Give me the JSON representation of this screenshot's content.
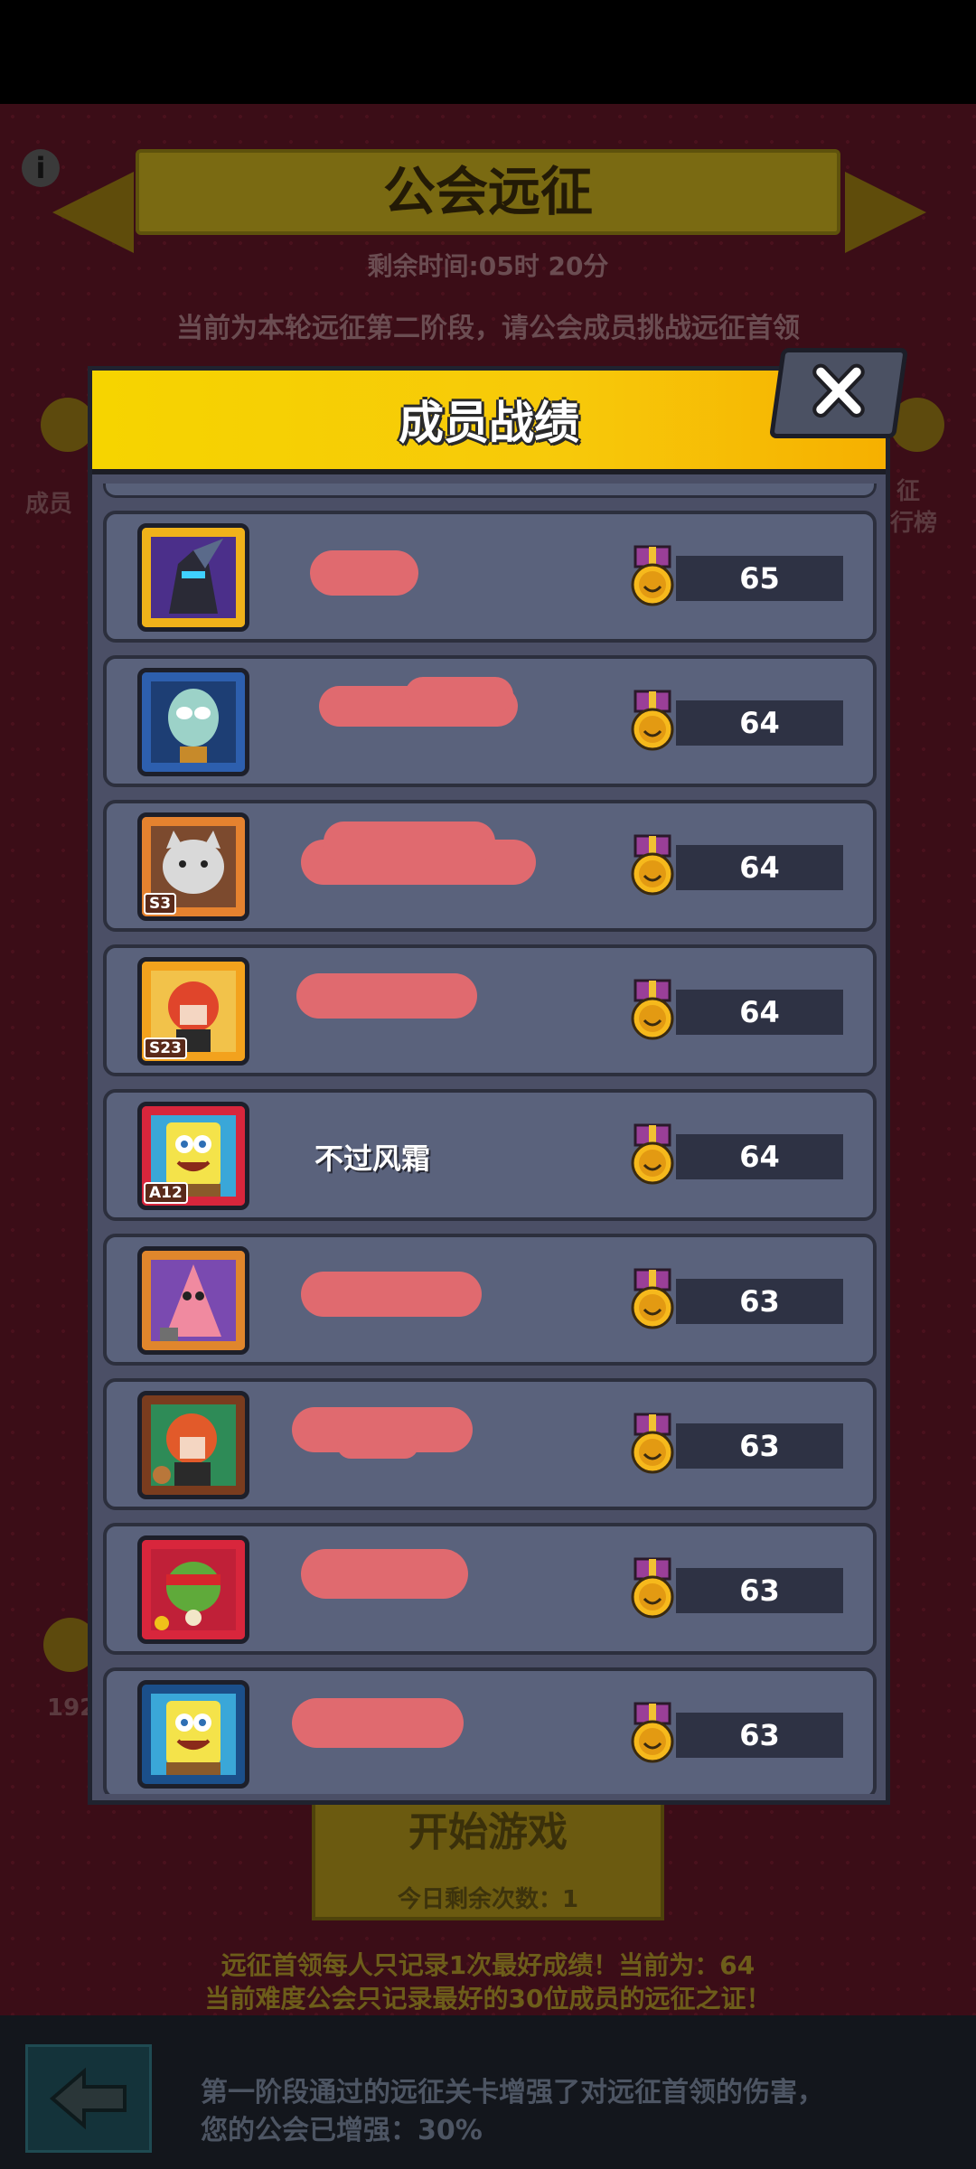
{
  "background": {
    "title": "公会远征",
    "time_remaining": "剩余时间:05时 20分",
    "stage_notice": "当前为本轮远征第二阶段，请公会成员挑战远征首领",
    "left_label": "成员",
    "right_label_top": "征",
    "right_label_bottom": "行榜",
    "left_bottom_number": "192",
    "start_button": "开始游戏",
    "remaining_tries": "今日剩余次数：1",
    "note_line1": "远征首领每人只记录1次最好成绩！当前为：64",
    "note_line2": "当前难度公会只记录最好的30位成员的远征之证！",
    "bottom_line1": "第一阶段通过的远征关卡增强了对远征首领的伤害，",
    "bottom_line2": "您的公会已增强：30%",
    "info_icon": "i"
  },
  "modal": {
    "title": "成员战绩",
    "close_icon": "close-icon",
    "members": [
      {
        "name": "",
        "score": "65",
        "avatar": "dark-knight-avatar",
        "frame_color": "#f0b21a",
        "badge": ""
      },
      {
        "name": "",
        "score": "64",
        "avatar": "squidward-avatar",
        "frame_color": "#2d5fae",
        "badge": ""
      },
      {
        "name": "",
        "score": "64",
        "avatar": "cat-avatar",
        "frame_color": "#e5822f",
        "badge": "S3"
      },
      {
        "name": "",
        "score": "64",
        "avatar": "red-hair-avatar",
        "frame_color": "#f3a21d",
        "badge": "S23"
      },
      {
        "name": "不过风霜",
        "score": "64",
        "avatar": "spongebob-avatar",
        "frame_color": "#d8263c",
        "badge": "A12"
      },
      {
        "name": "",
        "score": "63",
        "avatar": "patrick-avatar",
        "frame_color": "#e0862c",
        "badge": ""
      },
      {
        "name": "",
        "score": "63",
        "avatar": "ginger-avatar",
        "frame_color": "#7a3c1e",
        "badge": ""
      },
      {
        "name": "",
        "score": "63",
        "avatar": "ninja-turtle-avatar",
        "frame_color": "#d8263c",
        "badge": ""
      },
      {
        "name": "",
        "score": "63",
        "avatar": "spongebob-avatar",
        "frame_color": "#1b4f8a",
        "badge": ""
      }
    ]
  }
}
